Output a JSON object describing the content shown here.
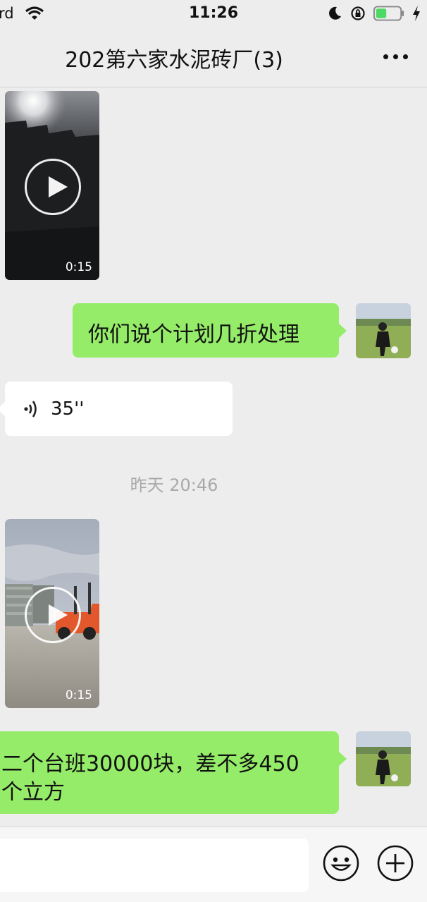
{
  "status_bar": {
    "carrier": "rd",
    "time": "11:26"
  },
  "nav": {
    "title": "202第六家水泥砖厂(3)",
    "more_icon": "more-dots-icon"
  },
  "messages": {
    "video1": {
      "duration": "0:15"
    },
    "text1": {
      "text": "你们说个计划几折处理"
    },
    "voice1": {
      "duration": "35''"
    },
    "timestamp": "昨天 20:46",
    "video2": {
      "duration": "0:15"
    },
    "text2": {
      "line1": "二个台班30000块，差不多450",
      "line2": "个立方"
    }
  },
  "input_bar": {
    "emoji_icon": "emoji-icon",
    "plus_icon": "plus-icon"
  },
  "colors": {
    "background": "#ededed",
    "sent_bubble": "#95ec69",
    "received_bubble": "#ffffff",
    "battery_fill": "#4cd964"
  }
}
